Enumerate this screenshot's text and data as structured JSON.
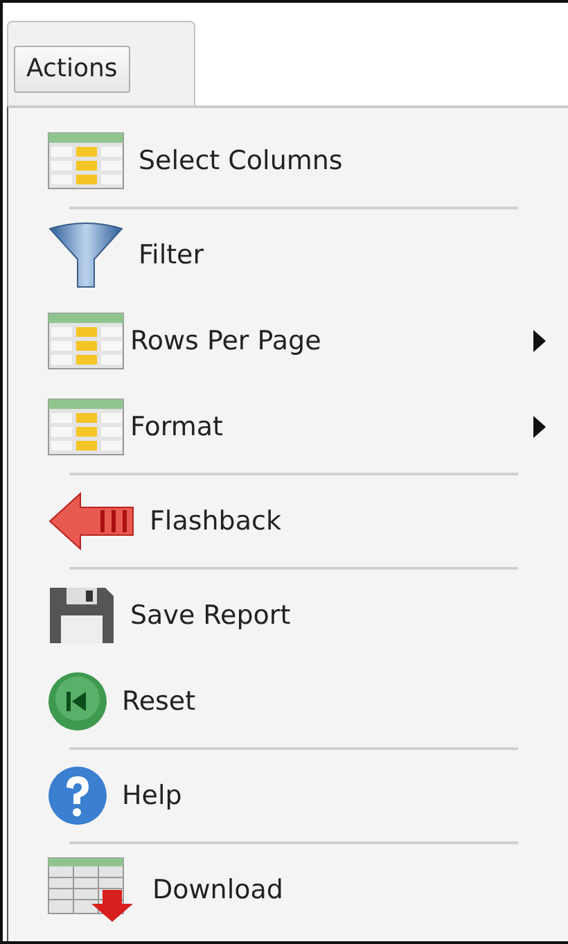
{
  "tab": {
    "label": "Actions"
  },
  "menu": [
    {
      "kind": "item",
      "label": "Select Columns",
      "submenu": false
    },
    {
      "kind": "separator"
    },
    {
      "kind": "item",
      "label": "Filter",
      "submenu": false
    },
    {
      "kind": "item",
      "label": "Rows Per Page",
      "submenu": true
    },
    {
      "kind": "item",
      "label": "Format",
      "submenu": true
    },
    {
      "kind": "separator"
    },
    {
      "kind": "item",
      "label": "Flashback",
      "submenu": false
    },
    {
      "kind": "separator"
    },
    {
      "kind": "item",
      "label": "Save Report",
      "submenu": false
    },
    {
      "kind": "item",
      "label": "Reset",
      "submenu": false
    },
    {
      "kind": "separator"
    },
    {
      "kind": "item",
      "label": "Help",
      "submenu": false
    },
    {
      "kind": "separator"
    },
    {
      "kind": "item",
      "label": "Download",
      "submenu": false
    }
  ]
}
